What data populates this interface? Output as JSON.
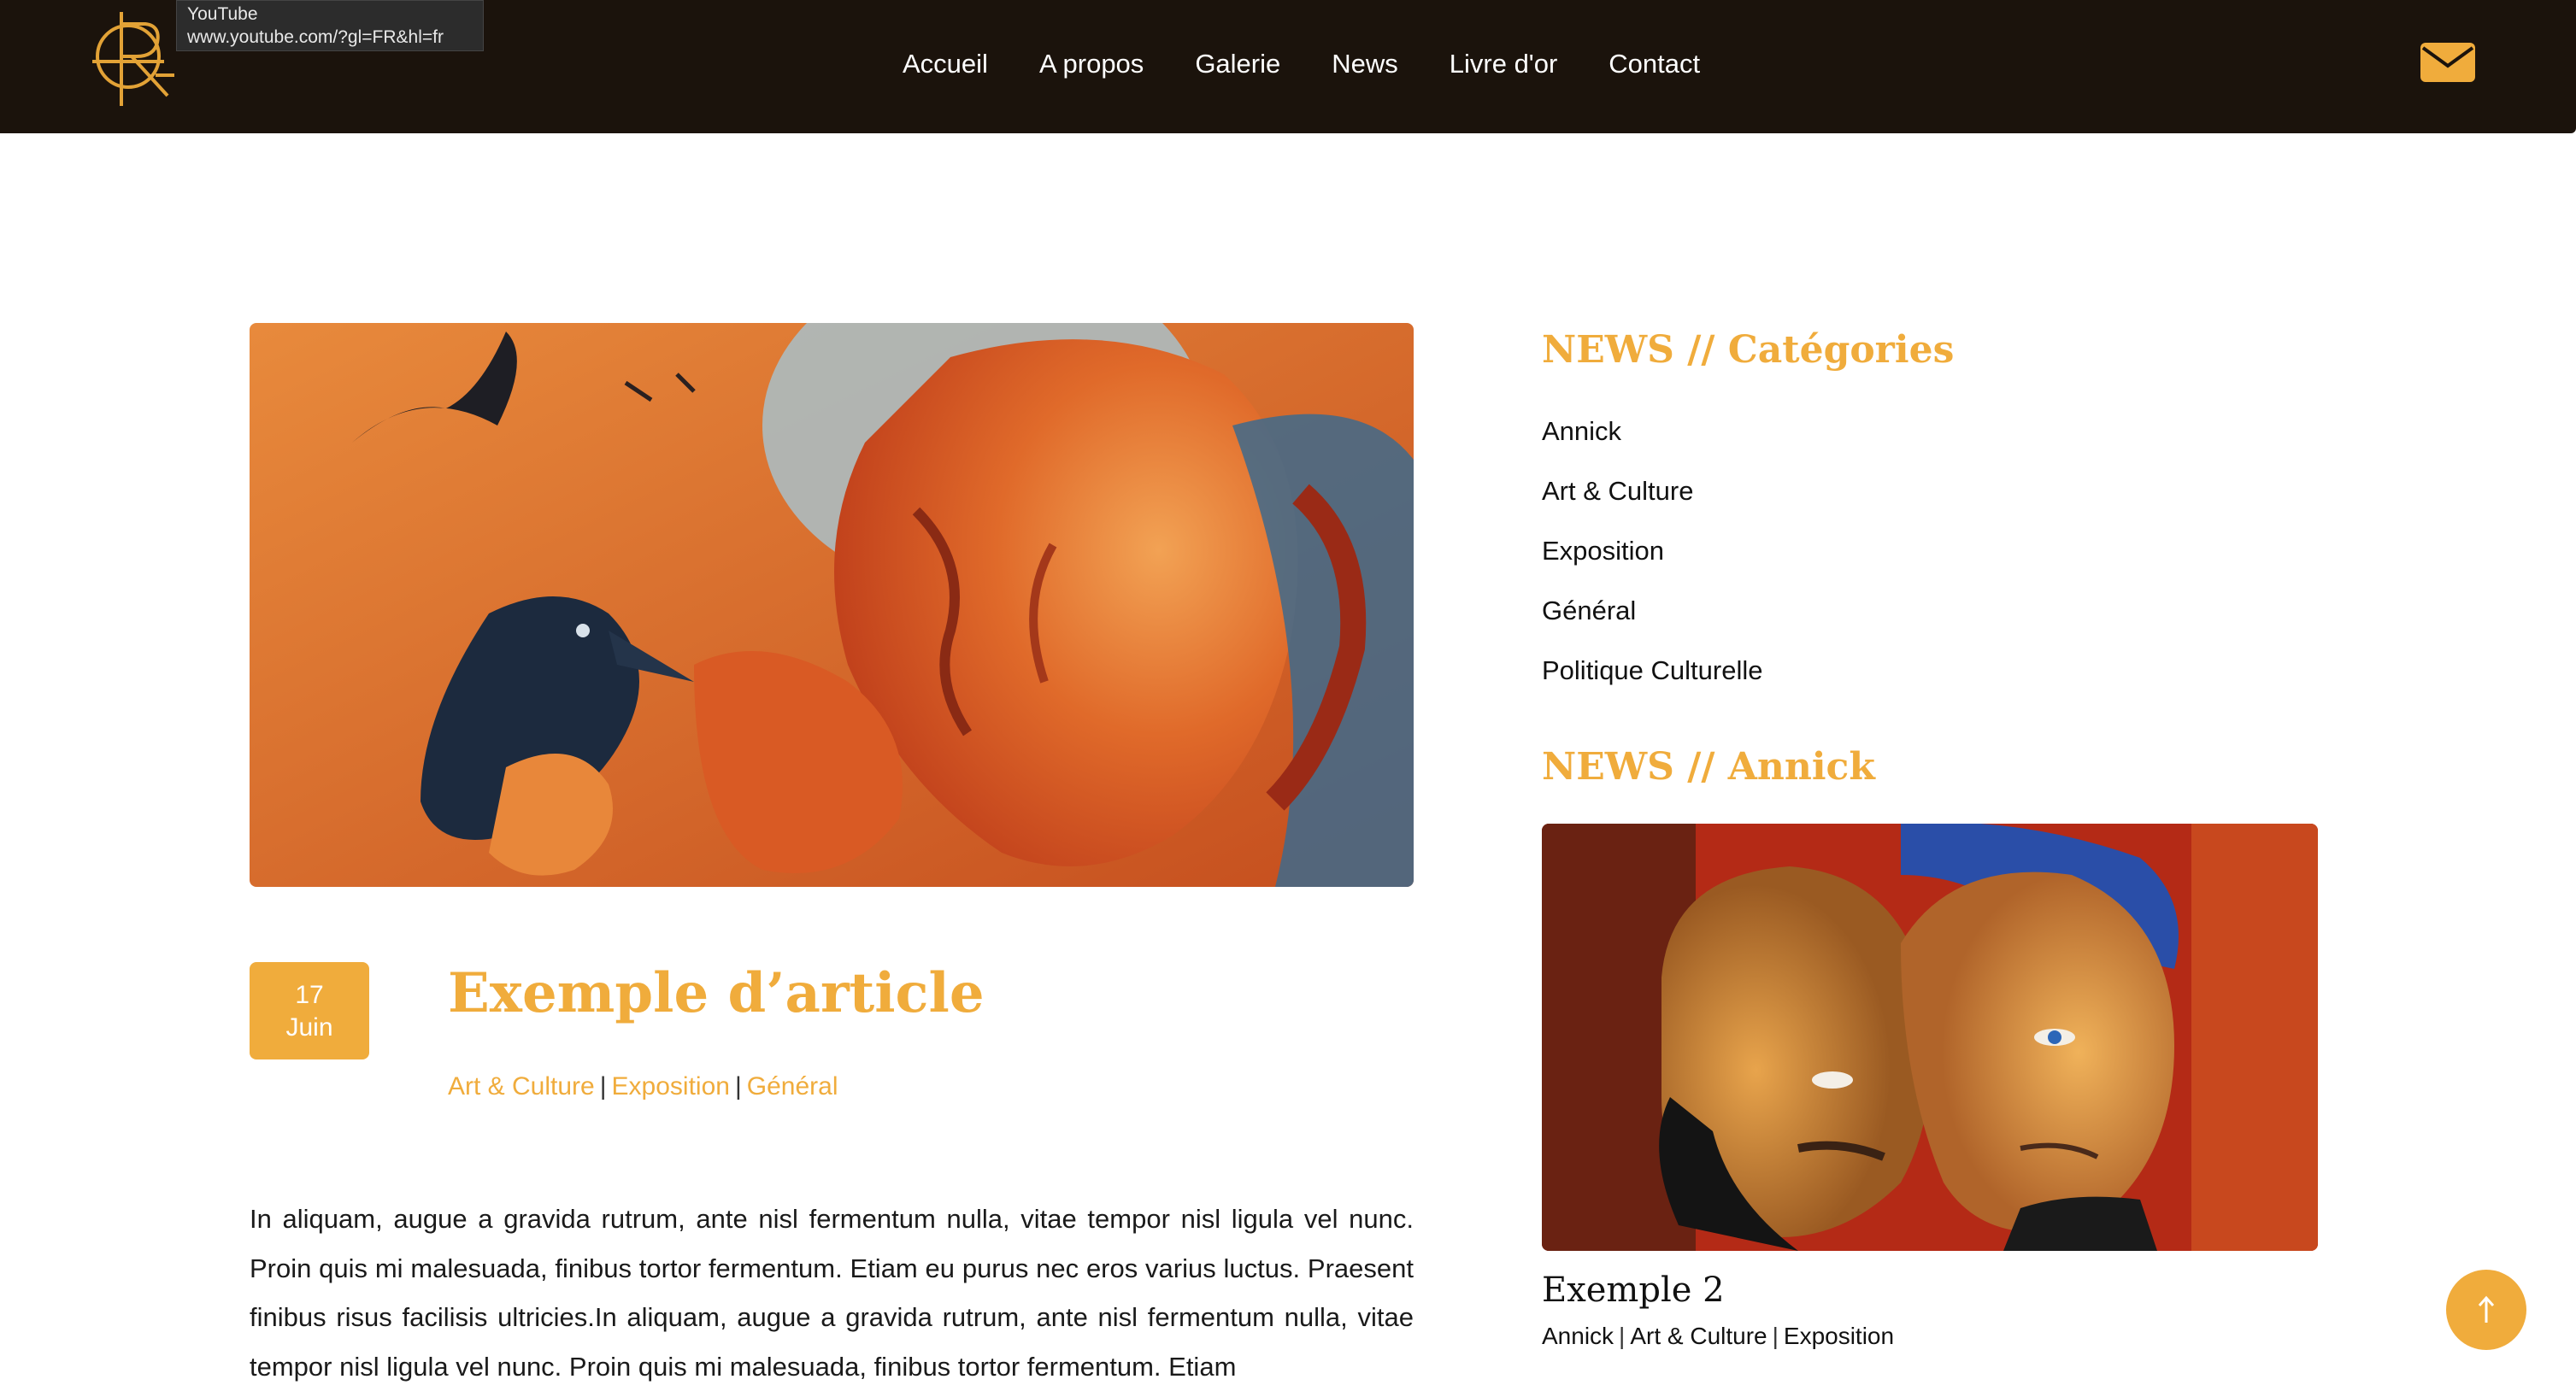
{
  "tooltip": {
    "title": "YouTube",
    "url": "www.youtube.com/?gl=FR&hl=fr"
  },
  "nav": {
    "items": [
      {
        "label": "Accueil"
      },
      {
        "label": "A propos"
      },
      {
        "label": "Galerie"
      },
      {
        "label": "News"
      },
      {
        "label": "Livre d'or"
      },
      {
        "label": "Contact"
      }
    ],
    "mail_icon": "envelope-icon"
  },
  "article": {
    "date_day": "17",
    "date_month": "Juin",
    "title": "Exemple d’article",
    "categories": [
      "Art & Culture",
      "Exposition",
      "Général"
    ],
    "body": "In aliquam, augue a gravida rutrum, ante nisl fermentum nulla, vitae tempor nisl ligula vel nunc. Proin quis mi malesuada, finibus tortor fermentum. Etiam eu purus nec eros varius luctus. Praesent finibus risus facilisis ultricies.In aliquam, augue a gravida rutrum, ante nisl fermentum nulla, vitae tempor nisl ligula vel nunc. Proin quis mi malesuada, finibus tortor fermentum. Etiam"
  },
  "sidebar": {
    "categories_heading": "NEWS // Catégories",
    "categories": [
      {
        "label": "Annick"
      },
      {
        "label": "Art & Culture"
      },
      {
        "label": "Exposition"
      },
      {
        "label": "Général"
      },
      {
        "label": "Politique Culturelle"
      }
    ],
    "annick_heading": "NEWS // Annick",
    "post": {
      "title": "Exemple 2",
      "categories": [
        "Annick",
        "Art & Culture",
        "Exposition"
      ]
    }
  },
  "colors": {
    "accent": "#f0ac3c",
    "header_bg": "#1b130c"
  },
  "icons": {
    "scroll_top": "arrow-up-icon",
    "logo": "logo-monogram"
  }
}
